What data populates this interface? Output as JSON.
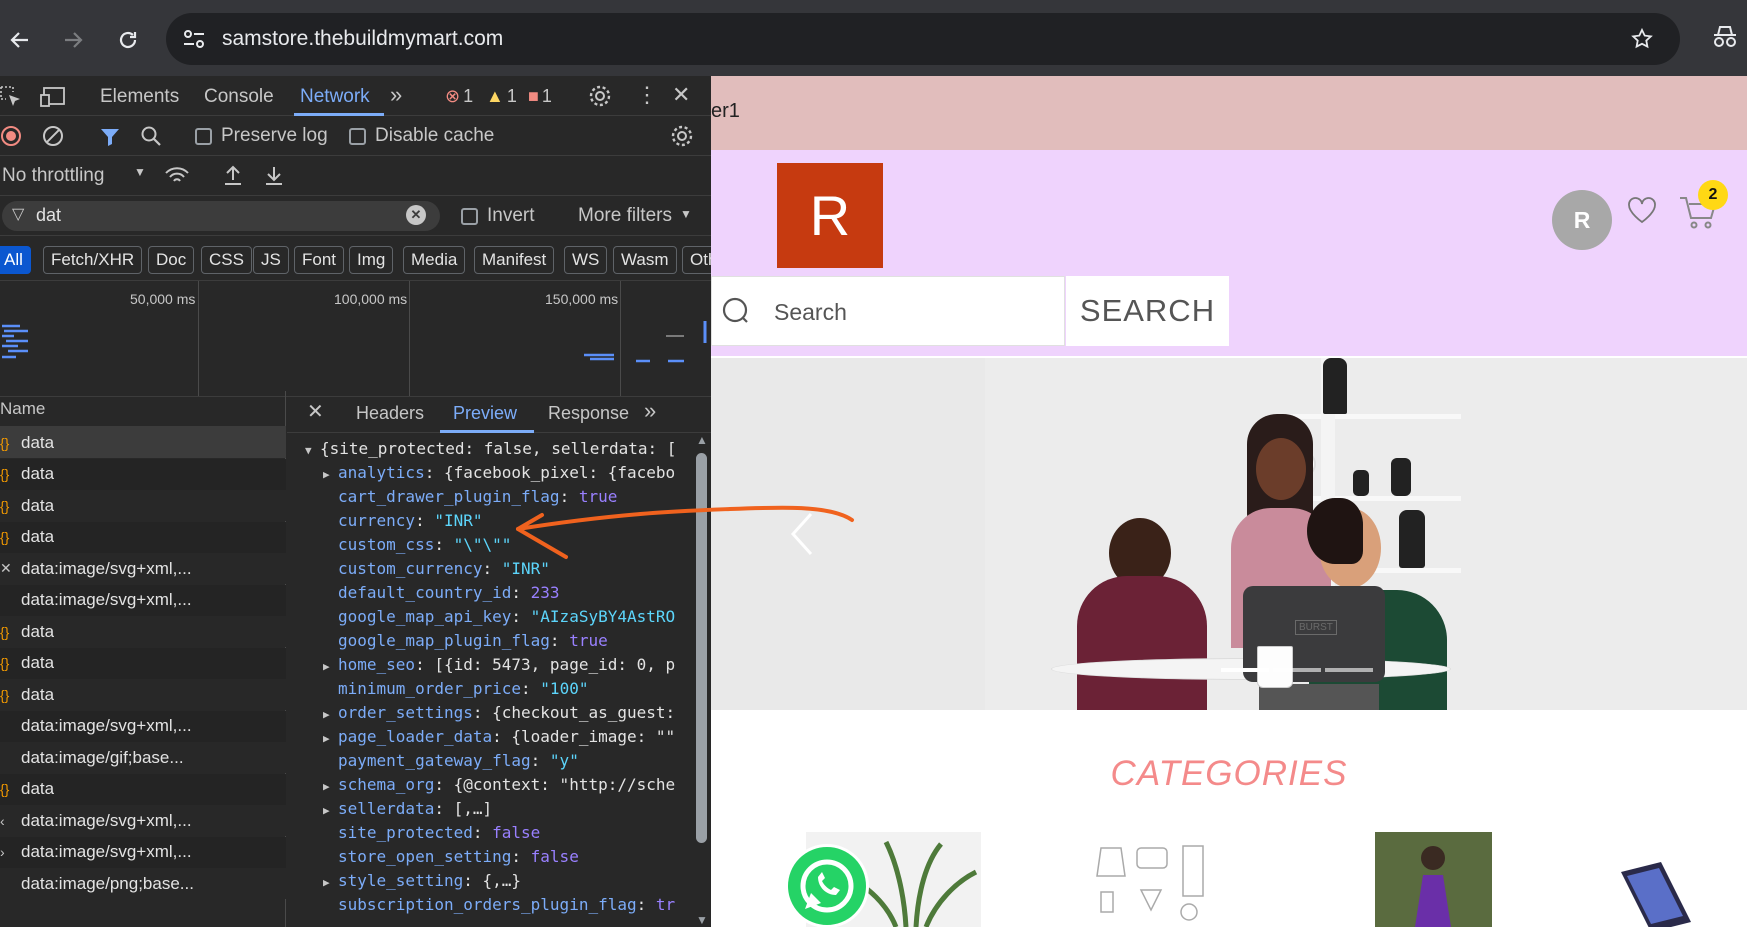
{
  "browser": {
    "url": "samstore.thebuildmymart.com"
  },
  "devtools": {
    "tabs": [
      "Elements",
      "Console",
      "Network"
    ],
    "active_tab": "Network",
    "errors": "1",
    "warnings": "1",
    "issues": "1",
    "preserve_log": "Preserve log",
    "disable_cache": "Disable cache",
    "throttling": "No throttling",
    "filter_value": "dat",
    "invert": "Invert",
    "more_filters": "More filters",
    "type_chips": [
      "All",
      "Fetch/XHR",
      "Doc",
      "CSS",
      "JS",
      "Font",
      "Img",
      "Media",
      "Manifest",
      "WS",
      "Wasm",
      "Oth"
    ],
    "timeline": [
      "50,000 ms",
      "100,000 ms",
      "150,000 ms"
    ],
    "name_header": "Name",
    "requests": [
      {
        "name": "data",
        "icon": "{}"
      },
      {
        "name": "data",
        "icon": "{}"
      },
      {
        "name": "data",
        "icon": "{}"
      },
      {
        "name": "data",
        "icon": "{}"
      },
      {
        "name": "data:image/svg+xml,...",
        "icon": "✕"
      },
      {
        "name": "data:image/svg+xml,...",
        "icon": ""
      },
      {
        "name": "data",
        "icon": "{}"
      },
      {
        "name": "data",
        "icon": "{}"
      },
      {
        "name": "data",
        "icon": "{}"
      },
      {
        "name": "data:image/svg+xml,...",
        "icon": ""
      },
      {
        "name": "data:image/gif;base...",
        "icon": ""
      },
      {
        "name": "data",
        "icon": "{}"
      },
      {
        "name": "data:image/svg+xml,...",
        "icon": "‹"
      },
      {
        "name": "data:image/svg+xml,...",
        "icon": "›"
      },
      {
        "name": "data:image/png;base...",
        "icon": ""
      }
    ],
    "preview_tabs": [
      "Headers",
      "Preview",
      "Response"
    ],
    "preview_active": "Preview",
    "preview_root": "{site_protected: false, sellerdata: [",
    "preview_lines": [
      {
        "tri": "▶",
        "key": "analytics",
        "val": "{facebook_pixel: {facebo",
        "kind": "obj"
      },
      {
        "tri": "",
        "key": "cart_drawer_plugin_flag",
        "val": "true",
        "kind": "bool"
      },
      {
        "tri": "",
        "key": "currency",
        "val": "\"INR\"",
        "kind": "str"
      },
      {
        "tri": "",
        "key": "custom_css",
        "val": "\"\\\"\\\"\"",
        "kind": "str"
      },
      {
        "tri": "",
        "key": "custom_currency",
        "val": "\"INR\"",
        "kind": "str"
      },
      {
        "tri": "",
        "key": "default_country_id",
        "val": "233",
        "kind": "num"
      },
      {
        "tri": "",
        "key": "google_map_api_key",
        "val": "\"AIzaSyBY4AstRO",
        "kind": "str"
      },
      {
        "tri": "",
        "key": "google_map_plugin_flag",
        "val": "true",
        "kind": "bool"
      },
      {
        "tri": "▶",
        "key": "home_seo",
        "val": "[{id: 5473, page_id: 0, p",
        "kind": "obj"
      },
      {
        "tri": "",
        "key": "minimum_order_price",
        "val": "\"100\"",
        "kind": "str"
      },
      {
        "tri": "▶",
        "key": "order_settings",
        "val": "{checkout_as_guest:",
        "kind": "obj"
      },
      {
        "tri": "▶",
        "key": "page_loader_data",
        "val": "{loader_image: \"\"",
        "kind": "obj"
      },
      {
        "tri": "",
        "key": "payment_gateway_flag",
        "val": "\"y\"",
        "kind": "str"
      },
      {
        "tri": "▶",
        "key": "schema_org",
        "val": "{@context: \"http://sche",
        "kind": "obj"
      },
      {
        "tri": "▶",
        "key": "sellerdata",
        "val": "[,…]",
        "kind": "obj"
      },
      {
        "tri": "",
        "key": "site_protected",
        "val": "false",
        "kind": "bool"
      },
      {
        "tri": "",
        "key": "store_open_setting",
        "val": "false",
        "kind": "bool"
      },
      {
        "tri": "▶",
        "key": "style_setting",
        "val": "{,…}",
        "kind": "obj"
      },
      {
        "tri": "",
        "key": "subscription_orders_plugin_flag",
        "val": "tr",
        "kind": "bool"
      }
    ]
  },
  "page": {
    "announcement": "er1",
    "logo_letter": "R",
    "search_placeholder": "Search",
    "search_button": "SEARCH",
    "avatar_letter": "R",
    "cart_count": "2",
    "categories_title": "CATEGORIES",
    "hero_laptop_text": "BURST"
  },
  "colors": {
    "announcement_bg": "#e1bdbc",
    "header_bg": "#efd3fd",
    "logo_bg": "#c63a10",
    "annotation_arrow": "#f0621e"
  }
}
